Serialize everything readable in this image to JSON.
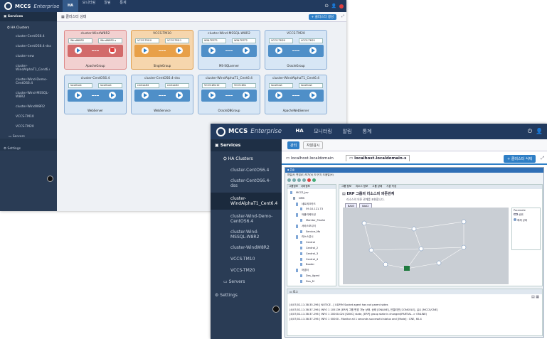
{
  "app": {
    "brand": "MCCS",
    "edition": "Enterprise"
  },
  "colors": {
    "topbar": "#223a5e",
    "sidebar": "#2a3c55",
    "accent": "#2f7fc6",
    "alert": "#e04040",
    "group_blue": "#d7e6f5",
    "group_red": "#f2d0d0",
    "group_orange": "#f6d6ad"
  },
  "s1": {
    "tabs": [
      "HA",
      "모니터링",
      "알림",
      "통계"
    ],
    "sidebar": {
      "services": "Services",
      "ha_clusters": "HA Clusters",
      "clusters": [
        "cluster-CentOS6.4",
        "cluster-CentOS6.4-dss",
        "cluster-new",
        "cluster-WindAlphaT1_Cent6.4",
        "cluster-Wind-Demo-CentOS6.4",
        "cluster-Wind-MSSQL-W8R2",
        "cluster-WindW8R2",
        "VCCS-TM10",
        "VCCS-TM20"
      ],
      "servers": "Servers",
      "settings": "Settings"
    },
    "panel_title": "클러스터 상태",
    "panel_btn": "+ 클러스터 생성",
    "groups": [
      {
        "title": "cluster-WindW8R2",
        "nodes": [
          "WindW8R2",
          "WindW8R2-s"
        ],
        "name": "ApacheGroup",
        "state": "error"
      },
      {
        "title": "VCCS-TM10",
        "nodes": [
          "VCCS-TM10",
          "VCCS-TM11"
        ],
        "name": "SingleGroup",
        "state": "warning"
      },
      {
        "title": "cluster-Wind-MSSQL-W8R2",
        "nodes": [
          "WIN-TEST1",
          "WIN-TEST2"
        ],
        "name": "MS-SQLserver",
        "state": "normal"
      },
      {
        "title": "VCCS-TM20",
        "nodes": [
          "VCCS-TM20",
          "VCCS-TM21"
        ],
        "name": "OracleGroup",
        "state": "normal"
      },
      {
        "title": "cluster-CentOS6.4",
        "nodes": [
          "localhost",
          "localhost"
        ],
        "name": "WebServer",
        "state": "normal"
      },
      {
        "title": "cluster-CentOS6.4-dss",
        "nodes": [
          "centos64",
          "centos64"
        ],
        "name": "WebService",
        "state": "normal"
      },
      {
        "title": "cluster-WindAlphaT1_Cent6.4",
        "nodes": [
          "VCCS-Win12",
          "VCCS-Win"
        ],
        "name": "OracleDBGroup",
        "state": "normal"
      },
      {
        "title": "cluster-WindAlphaT1_Cent6.4",
        "nodes": [
          "localhost",
          "localhost"
        ],
        "name": "ApacheWebServer",
        "state": "normal"
      }
    ]
  },
  "s2": {
    "tabs": [
      "HA",
      "모니터링",
      "알림",
      "통계"
    ],
    "sidebar": {
      "services": "Services",
      "ha_clusters": "HA Clusters",
      "clusters": [
        "cluster-CentOS6.4",
        "cluster-CentOS6.4-dss",
        "cluster-WindAlphaT1_Cent6.4",
        "cluster-Wind-Demo-CentOS6.4",
        "cluster-Wind-MSSQL-W8R2",
        "cluster-WindW8R2",
        "VCCS-TM10",
        "VCCS-TM20"
      ],
      "servers": "Servers",
      "settings": "Settings"
    },
    "subtabs": [
      "관리",
      "자원감시"
    ],
    "hosts": [
      "localhost.localdomain",
      "localhost.localdomain-s"
    ],
    "delete_btn": "+ 클러스터 삭제",
    "menu": "파일(F)  편집(E)  보기(V)  도구(T)  도움말(H)",
    "left_tabs": [
      "그룹정보",
      "서버정보"
    ],
    "tree": [
      "MCCS_Jav",
      "NMS",
      "네트워크카드",
      "59.10.121.73",
      "어플리케이션",
      "Monitor_Flashe",
      "서비스모니터",
      "Service_Mo",
      "리소스감시",
      "Central",
      "Central_2",
      "Central_3",
      "Central_4",
      "Booter",
      "어댑터",
      "Dns_Agent",
      "Dns_M"
    ],
    "right_tabs": [
      "그룹 정보",
      "리소스 정보",
      "그룹 상태",
      "기본 속성"
    ],
    "group_title": "ERP 그룹의 리소스의 의존관계",
    "group_sub": "리소스의 의존 관계를 표현합니다.",
    "btns": [
      "BA03",
      "BA02"
    ],
    "legend": [
      "Paramete",
      "상위",
      "해제 상태"
    ],
    "log_tab": "로그",
    "logs": [
      "[4/07/02-11:38:35.296 ] NOTICE - [ UDP/M Socket agent has not parent sides",
      "[4/07/02-11:38:37.296 ] INFO 1 105139 [ERP] 그룹 변경 가능 상태. 상태 [ONLINE], 인텔리젼 [CONSOLE], 실수 [MCCS/CNE]",
      "[4/07/02-11:38:37.296 ] INFO 1 20000-024 [SNVC] state, [ERP] group state is changed(PARTIAL -> ONLINE)",
      "[4/07/02-11:38:37.296 ] INFO 1 00000 - Monitor all 1 seconds successful status and [Mode] : CNE, 60-4"
    ]
  }
}
